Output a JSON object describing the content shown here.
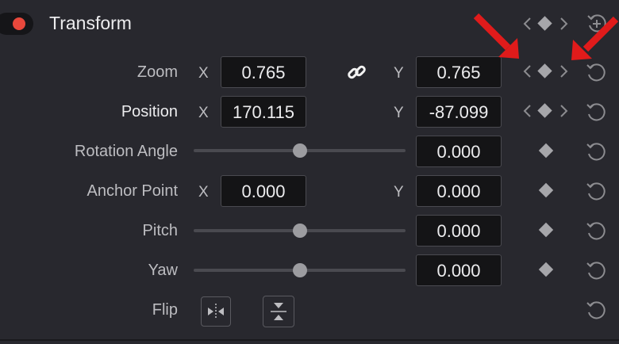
{
  "panel": {
    "title": "Transform",
    "toggle_color": "#e8483c",
    "enabled": true
  },
  "axis_labels": {
    "x": "X",
    "y": "Y"
  },
  "rows": {
    "zoom": {
      "label": "Zoom",
      "x": "0.765",
      "y": "0.765",
      "linked": true
    },
    "position": {
      "label": "Position",
      "x": "170.115",
      "y": "-87.099"
    },
    "rotation": {
      "label": "Rotation Angle",
      "value": "0.000",
      "slider": 0.5
    },
    "anchor": {
      "label": "Anchor Point",
      "x": "0.000",
      "y": "0.000"
    },
    "pitch": {
      "label": "Pitch",
      "value": "0.000",
      "slider": 0.5
    },
    "yaw": {
      "label": "Yaw",
      "value": "0.000",
      "slider": 0.5
    },
    "flip": {
      "label": "Flip"
    }
  },
  "icons": {
    "keyframe": "diamond-icon",
    "prev": "chevron-left-icon",
    "next": "chevron-right-icon",
    "reset": "reset-icon",
    "link": "link-icon",
    "flip_h": "flip-horizontal-icon",
    "flip_v": "flip-vertical-icon",
    "annotation": "red-arrow-icon"
  },
  "colors": {
    "background": "#28282e",
    "field_bg": "#141416",
    "annotation_red": "#e01b1b"
  }
}
